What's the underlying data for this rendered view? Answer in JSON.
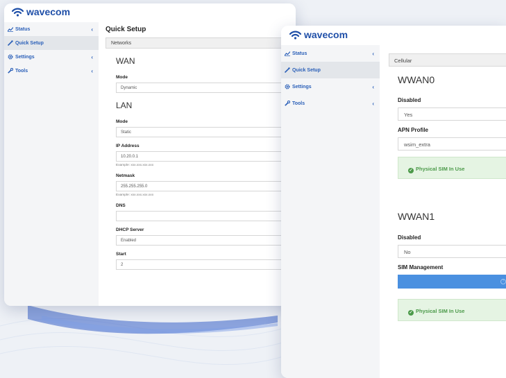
{
  "brand": {
    "name": "wavecom",
    "color": "#1f4fa8"
  },
  "back_window": {
    "sidebar": [
      {
        "label": "Status",
        "icon": "chart-icon",
        "has_chevron": true,
        "active": false
      },
      {
        "label": "Quick Setup",
        "icon": "wand-icon",
        "has_chevron": false,
        "active": true
      },
      {
        "label": "Settings",
        "icon": "gear-icon",
        "has_chevron": true,
        "active": false
      },
      {
        "label": "Tools",
        "icon": "wrench-icon",
        "has_chevron": true,
        "active": false
      }
    ],
    "page_title": "Quick Setup",
    "panel_title": "Networks",
    "wan": {
      "heading": "WAN",
      "mode_label": "Mode",
      "mode_value": "Dynamic"
    },
    "lan": {
      "heading": "LAN",
      "mode_label": "Mode",
      "mode_value": "Static",
      "ip_label": "IP Address",
      "ip_value": "10.20.0.1",
      "ip_hint": "Example: xxx.xxx.xxx.xxx",
      "netmask_label": "Netmask",
      "netmask_value": "255.255.255.0",
      "netmask_hint": "Example: xxx.xxx.xxx.xxx",
      "dns_label": "DNS",
      "dns_value": "",
      "dhcp_label": "DHCP Server",
      "dhcp_value": "Enabled",
      "start_label": "Start",
      "start_value": "2"
    }
  },
  "front_window": {
    "sidebar": [
      {
        "label": "Status",
        "icon": "chart-icon",
        "has_chevron": true,
        "active": false
      },
      {
        "label": "Quick Setup",
        "icon": "wand-icon",
        "has_chevron": false,
        "active": true
      },
      {
        "label": "Settings",
        "icon": "gear-icon",
        "has_chevron": true,
        "active": false
      },
      {
        "label": "Tools",
        "icon": "wrench-icon",
        "has_chevron": true,
        "active": false
      }
    ],
    "panel_title": "Cellular",
    "wwan0": {
      "heading": "WWAN0",
      "disabled_label": "Disabled",
      "disabled_value": "Yes",
      "apn_label": "APN Profile",
      "apn_value": "wsim_extra",
      "sim_status": "Physical SIM In Use"
    },
    "wwan1": {
      "heading": "WWAN1",
      "disabled_label": "Disabled",
      "disabled_value": "No",
      "sim_mgmt_label": "SIM Management",
      "sim_status": "Physical SIM In Use"
    }
  },
  "colors": {
    "sidebar_link": "#2a5fb8",
    "sim_ok_bg": "#e5f4e3",
    "sim_ok_text": "#4c9a4a",
    "sim_bar": "#4a90e0"
  }
}
